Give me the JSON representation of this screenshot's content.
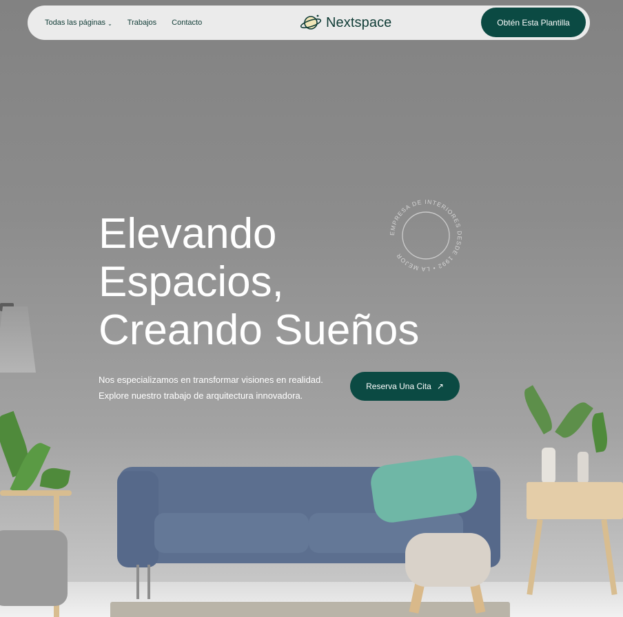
{
  "nav": {
    "links": [
      {
        "label": "Todas las páginas",
        "has_dropdown": true
      },
      {
        "label": "Trabajos"
      },
      {
        "label": "Contacto"
      }
    ],
    "brand": "Nextspace",
    "cta_label": "Obtén Esta Plantilla"
  },
  "hero": {
    "title_lines": [
      "Elevando",
      "Espacios,",
      "Creando Sueños"
    ],
    "description_lines": [
      "Nos especializamos en transformar visiones en realidad.",
      "Explore nuestro trabajo de arquitectura innovadora."
    ],
    "cta_label": "Reserva Una Cita",
    "badge_text": "EMPRESA DE INTERIORES DESDE 1992 • LA MEJOR "
  },
  "icons": {
    "dropdown": "chevron-down-icon",
    "brand": "planet-icon",
    "cta": "arrow-up-right-icon"
  },
  "colors": {
    "accent": "#0b4a43",
    "nav_bg": "#ebebeb",
    "text_dark": "#0f3b35"
  }
}
